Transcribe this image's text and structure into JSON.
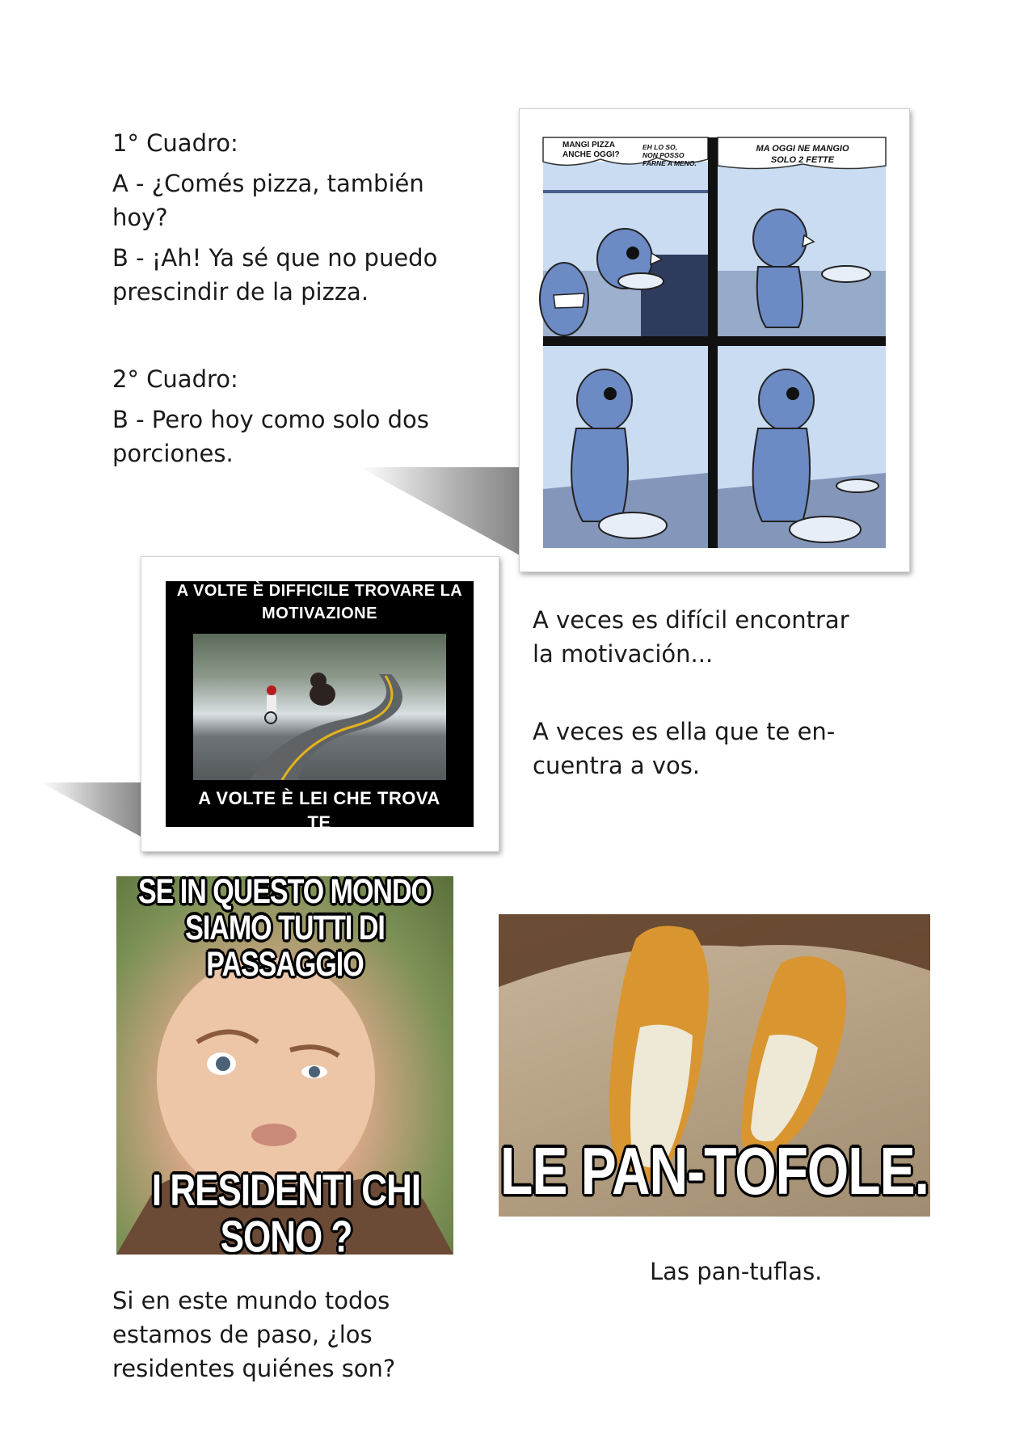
{
  "comic": {
    "label_1": "1° Cuadro:",
    "line_a": "A - ¿Comés pizza, también hoy?",
    "line_b": "B - ¡Ah! Ya sé que no puedo prescindir de la pizza.",
    "label_2": "2° Cuadro:",
    "line_b2": "B - Pero hoy como solo dos porciones.",
    "bubble_1": "MANGI PIZZA ANCHE OGGI?",
    "bubble_2": "EH LO SO, NON POSSO FARNE A MENO.",
    "bubble_3": "MA OGGI NE MANGIO SOLO 2 FETTE"
  },
  "motivation": {
    "top_text": "A VOLTE È DIFFICILE TROVARE LA MOTIVAZIONE",
    "bottom_text": "A VOLTE È LEI CHE TROVA TE",
    "caption_1": "A veces es difícil encontrar la motivación...",
    "caption_2": "A veces es ella que te en-cuentra a vos."
  },
  "baby": {
    "top_text": "SE IN QUESTO MONDO SIAMO TUTTI DI PASSAGGIO",
    "bottom_text": "I RESIDENTI CHI SONO ?",
    "caption": "Si en este mundo todos estamos de paso, ¿los residentes quiénes son?"
  },
  "bread": {
    "meme_text": "LE PAN-TOFOLE.",
    "caption": "Las pan-tuflas."
  },
  "colors": {
    "comic_bg": "#c9dcf2",
    "comic_char": "#6c8ac4",
    "comic_dark": "#4a5f8c"
  }
}
